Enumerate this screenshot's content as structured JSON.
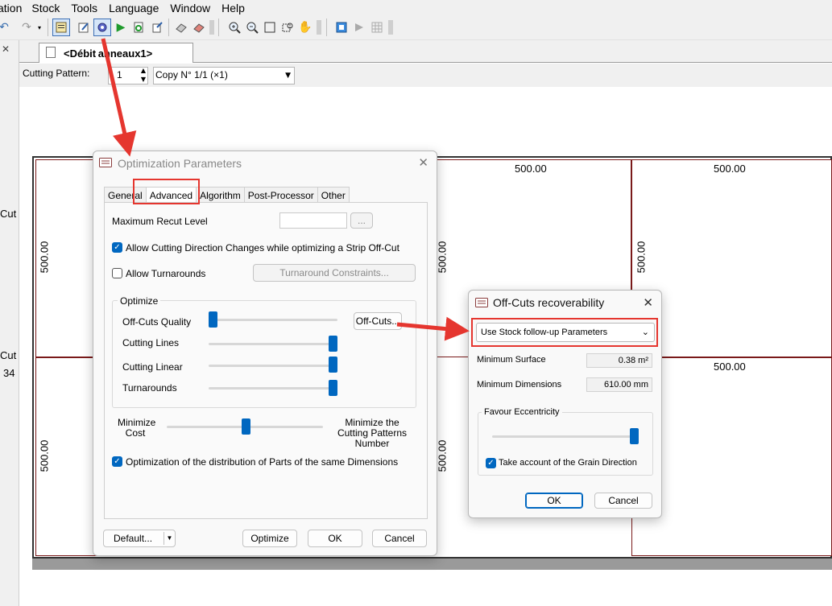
{
  "menu": [
    "ation",
    "Stock",
    "Tools",
    "Language",
    "Window",
    "Help"
  ],
  "toolbar": {
    "icons": [
      "undo-icon",
      "redo-icon",
      "properties-icon",
      "edit-icon",
      "optimization-parameters-icon",
      "run-icon",
      "refresh-icon",
      "export-icon",
      "print-icon",
      "print-setup-icon",
      "zoom-in-icon",
      "zoom-out-icon",
      "zoom-fit-icon",
      "pan-icon",
      "view-icon",
      "next-icon",
      "grid-icon"
    ]
  },
  "document_tab": {
    "label": "<Débit anneaux1>"
  },
  "pattern_row": {
    "label": "Cutting Pattern:",
    "value": "1",
    "copy_value": "Copy N° 1/1 (×1)"
  },
  "left_texts": [
    "Cut",
    "Cut",
    "34"
  ],
  "canvas": {
    "dim_top": [
      "500.00",
      "500.00",
      "500.00"
    ],
    "dim_side": [
      "500.00",
      "500.00",
      "500.00",
      "500.00",
      "500.00"
    ]
  },
  "opt_dialog": {
    "title": "Optimization Parameters",
    "tabs": [
      "General",
      "Advanced",
      "Algorithm",
      "Post-Processor",
      "Other"
    ],
    "active_tab": "Advanced",
    "max_recut_label": "Maximum Recut Level",
    "max_recut_value": "",
    "browse_label": "...",
    "allow_direction_label": "Allow Cutting Direction Changes while optimizing a Strip Off-Cut",
    "allow_direction_checked": true,
    "allow_turnarounds_label": "Allow Turnarounds",
    "allow_turnarounds_checked": false,
    "turnaround_constraints_label": "Turnaround Constraints...",
    "optimize_group_label": "Optimize",
    "sliders": [
      {
        "label": "Off-Cuts Quality",
        "level": 0.0
      },
      {
        "label": "Cutting Lines",
        "level": 1.0
      },
      {
        "label": "Cutting Linear",
        "level": 1.0
      },
      {
        "label": "Turnarounds",
        "level": 1.0
      }
    ],
    "offcuts_button": "Off-Cuts...",
    "minimize_cost_label": "Minimize Cost",
    "minimize_patterns_label": "Minimize the Cutting Patterns Number",
    "cost_vs_patterns_level": 0.5,
    "distribution_label": "Optimization of the distribution of Parts of the same Dimensions",
    "distribution_checked": true,
    "default_button": "Default...",
    "optimize_button": "Optimize",
    "ok_button": "OK",
    "cancel_button": "Cancel"
  },
  "offcuts_dialog": {
    "title": "Off-Cuts recoverability",
    "mode_value": "Use Stock follow-up Parameters",
    "min_surface_label": "Minimum Surface",
    "min_surface_value": "0.38 m²",
    "min_dimensions_label": "Minimum Dimensions",
    "min_dimensions_value": "610.00 mm",
    "favour_eccentricity_label": "Favour Eccentricity",
    "favour_eccentricity_level": 1.0,
    "grain_label": "Take account of the Grain Direction",
    "grain_checked": true,
    "ok_button": "OK",
    "cancel_button": "Cancel"
  },
  "colors": {
    "accent": "#0067c0",
    "highlight": "#e5362f",
    "panel_border": "#7a1a1a"
  }
}
